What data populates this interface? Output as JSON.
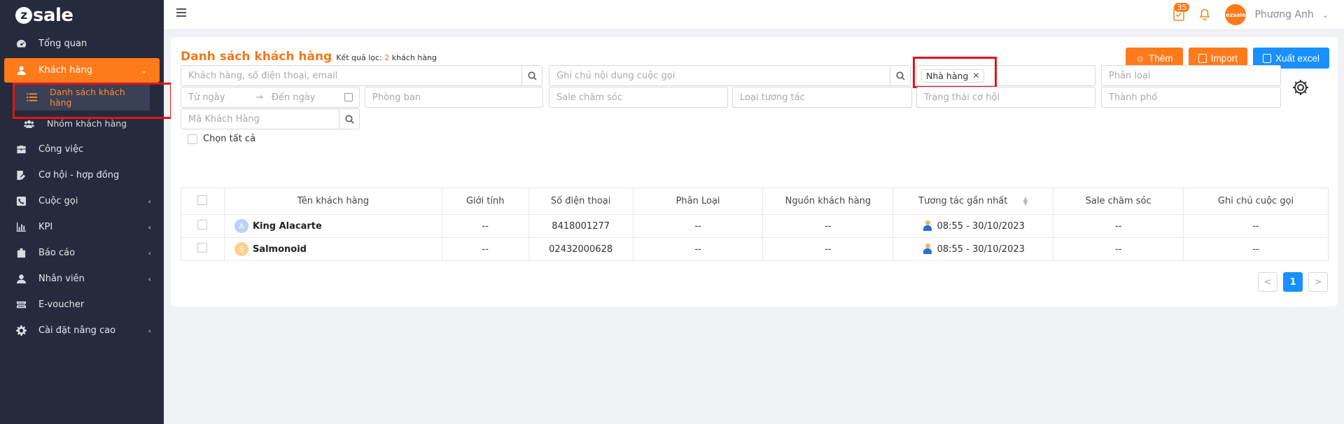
{
  "brand": {
    "name": "sale",
    "mark": "z"
  },
  "sidebar": {
    "items": [
      {
        "label": "Tổng quan"
      },
      {
        "label": "Khách hàng"
      },
      {
        "label": "Công việc"
      },
      {
        "label": "Cơ hội - hợp đồng"
      },
      {
        "label": "Cuộc gọi"
      },
      {
        "label": "KPI"
      },
      {
        "label": "Báo cáo"
      },
      {
        "label": "Nhân viên"
      },
      {
        "label": "E-voucher"
      },
      {
        "label": "Cài đặt nâng cao"
      }
    ],
    "subitems": [
      {
        "label": "Danh sách khách hàng"
      },
      {
        "label": "Nhóm khách hàng"
      }
    ]
  },
  "topbar": {
    "task_badge": "35",
    "avatar_text": "ezsale",
    "username": "Phương Anh"
  },
  "page": {
    "title": "Danh sách khách hàng",
    "filter_prefix": "Kết quả lọc:",
    "filter_count": "2",
    "filter_suffix": "khách hàng",
    "buttons": {
      "add": "Thêm",
      "import": "Import",
      "export": "Xuất excel"
    }
  },
  "filters": {
    "customer_search": "Khách hàng, số điện thoại, email",
    "call_note_search": "Ghi chú nội dung cuộc gọi",
    "source_tag": "Nhà hàng",
    "category": "Phân loại",
    "from_date": "Từ ngày",
    "to_date": "Đến ngày",
    "department": "Phòng ban",
    "sale": "Sale chăm sóc",
    "interaction_type": "Loại tương tác",
    "opportunity_status": "Trạng thái cơ hội",
    "city": "Thành phố",
    "customer_code": "Mã Khách Hàng"
  },
  "select_all": "Chọn tất cả",
  "table": {
    "headers": [
      "Tên khách hàng",
      "Giới tính",
      "Số điện thoại",
      "Phân Loại",
      "Nguồn khách hàng",
      "Tương tác gần nhất",
      "Sale chăm sóc",
      "Ghi chú cuộc gọi"
    ],
    "rows": [
      {
        "initial": "A",
        "name": "King Alacarte",
        "gender": "--",
        "phone": "8418001277",
        "category": "--",
        "source": "--",
        "last_interaction": "08:55 - 30/10/2023",
        "sale": "--",
        "note": "--"
      },
      {
        "initial": "S",
        "name": "Salmonoid",
        "gender": "--",
        "phone": "02432000628",
        "category": "--",
        "source": "--",
        "last_interaction": "08:55 - 30/10/2023",
        "sale": "--",
        "note": "--"
      }
    ]
  },
  "pagination": {
    "current": "1",
    "prev": "<",
    "next": ">"
  },
  "colors": {
    "sidebar_bg": "#252a3c",
    "accent": "#ff7a1a",
    "primary": "#1890ff",
    "highlight_box": "#e3141b"
  }
}
